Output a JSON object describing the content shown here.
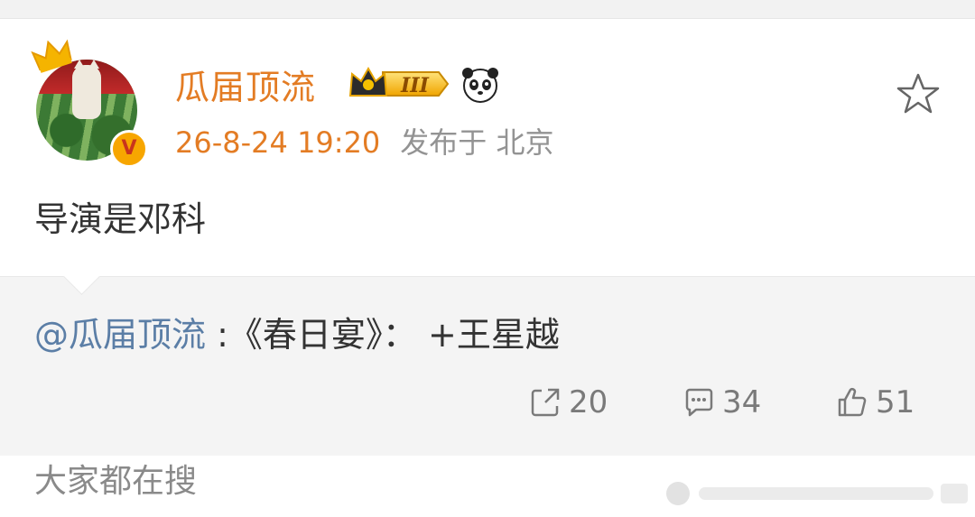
{
  "post": {
    "username": "瓜届顶流",
    "level_badge": "III",
    "timestamp": "26-8-24 19:20",
    "location": "发布于 北京",
    "content": "导演是邓科"
  },
  "repost": {
    "mention": "@瓜届顶流",
    "separator": " :",
    "text": "《春日宴》： +王星越"
  },
  "actions": {
    "repost_count": "20",
    "comment_count": "34",
    "like_count": "51"
  },
  "footer": {
    "trending_label": "大家都在搜"
  },
  "colors": {
    "username": "#e37c24",
    "mention": "#5b7ea6",
    "muted": "#939393",
    "repost_bg": "#f4f4f4"
  },
  "icons": [
    "crown-icon",
    "vip-v-icon",
    "level-crown-icon",
    "panda-icon",
    "star-icon",
    "repost-icon",
    "comment-icon",
    "like-icon"
  ]
}
